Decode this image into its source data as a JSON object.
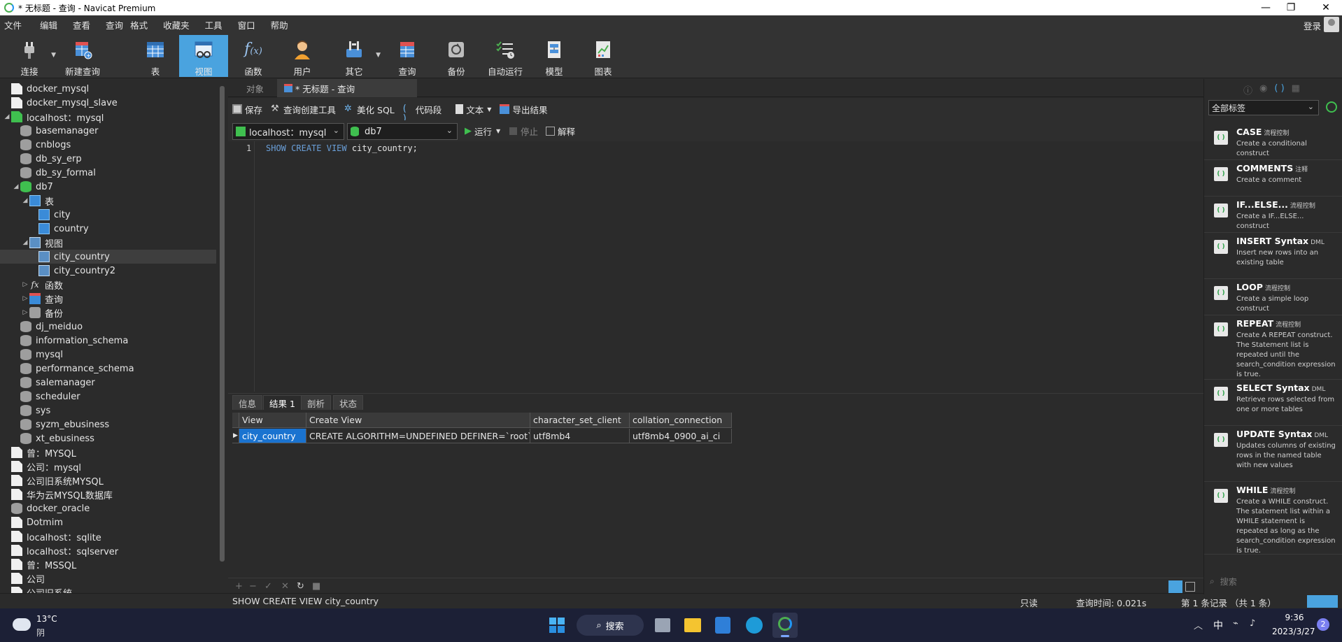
{
  "window": {
    "title": "* 无标题 - 查询 - Navicat Premium",
    "controls": [
      "—",
      "❐",
      "✕"
    ]
  },
  "menu": {
    "items": [
      "文件",
      "编辑",
      "查看",
      "查询",
      "格式",
      "收藏夹",
      "工具",
      "窗口",
      "帮助"
    ],
    "login_label": "登录"
  },
  "toolbar": {
    "items": [
      {
        "label": "连接",
        "icon": "plug-icon"
      },
      {
        "label": "新建查询",
        "icon": "new-query-icon"
      },
      {
        "label": "表",
        "icon": "table-icon"
      },
      {
        "label": "视图",
        "icon": "view-icon"
      },
      {
        "label": "函数",
        "icon": "function-icon"
      },
      {
        "label": "用户",
        "icon": "user-icon"
      },
      {
        "label": "其它",
        "icon": "tools-icon"
      },
      {
        "label": "查询",
        "icon": "query-icon"
      },
      {
        "label": "备份",
        "icon": "backup-icon"
      },
      {
        "label": "自动运行",
        "icon": "auto-run-icon"
      },
      {
        "label": "模型",
        "icon": "model-icon"
      },
      {
        "label": "图表",
        "icon": "chart-icon"
      }
    ],
    "active": "视图"
  },
  "tree": {
    "items": [
      {
        "label": "docker_mysql",
        "kind": "conn"
      },
      {
        "label": "docker_mysql_slave",
        "kind": "conn"
      },
      {
        "label": "localhost：mysql",
        "kind": "conn-open"
      },
      {
        "label": "basemanager",
        "kind": "db"
      },
      {
        "label": "cnblogs",
        "kind": "db"
      },
      {
        "label": "db_sy_erp",
        "kind": "db"
      },
      {
        "label": "db_sy_formal",
        "kind": "db"
      },
      {
        "label": "db7",
        "kind": "db-open"
      },
      {
        "label": "表",
        "kind": "tables"
      },
      {
        "label": "city",
        "kind": "table"
      },
      {
        "label": "country",
        "kind": "table"
      },
      {
        "label": "视图",
        "kind": "views"
      },
      {
        "label": "city_country",
        "kind": "view",
        "selected": true
      },
      {
        "label": "city_country2",
        "kind": "view"
      },
      {
        "label": "函数",
        "kind": "functions"
      },
      {
        "label": "查询",
        "kind": "queries"
      },
      {
        "label": "备份",
        "kind": "backups"
      },
      {
        "label": "dj_meiduo",
        "kind": "db"
      },
      {
        "label": "information_schema",
        "kind": "db"
      },
      {
        "label": "mysql",
        "kind": "db"
      },
      {
        "label": "performance_schema",
        "kind": "db"
      },
      {
        "label": "salemanager",
        "kind": "db"
      },
      {
        "label": "scheduler",
        "kind": "db"
      },
      {
        "label": "sys",
        "kind": "db"
      },
      {
        "label": "syzm_ebusiness",
        "kind": "db"
      },
      {
        "label": "xt_ebusiness",
        "kind": "db"
      },
      {
        "label": "曾：MYSQL",
        "kind": "conn"
      },
      {
        "label": "公司：mysql",
        "kind": "conn"
      },
      {
        "label": "公司旧系统MYSQL",
        "kind": "conn"
      },
      {
        "label": "华为云MYSQL数据库",
        "kind": "conn"
      },
      {
        "label": "docker_oracle",
        "kind": "conn-oracle"
      },
      {
        "label": "Dotmim",
        "kind": "conn-sqlite"
      },
      {
        "label": "localhost：sqlite",
        "kind": "conn-sqlite"
      },
      {
        "label": "localhost：sqlserver",
        "kind": "conn"
      },
      {
        "label": "曾：MSSQL",
        "kind": "conn"
      },
      {
        "label": "公司",
        "kind": "conn"
      },
      {
        "label": "公司旧系统",
        "kind": "conn"
      }
    ]
  },
  "tabs": {
    "objects": "对象",
    "query": "* 无标题 - 查询"
  },
  "query_toolbar": {
    "save": "保存",
    "builder": "查询创建工具",
    "beautify": "美化 SQL",
    "snippet": "代码段",
    "text": "文本",
    "export": "导出结果",
    "connection": "localhost：mysql",
    "database": "db7",
    "run": "运行",
    "stop": "停止",
    "explain": "解释"
  },
  "editor": {
    "line_number": "1",
    "kw1": "SHOW",
    "kw2": "CREATE",
    "kw3": "VIEW",
    "rest": "city_country;"
  },
  "result_tabs": [
    "信息",
    "结果 1",
    "剖析",
    "状态"
  ],
  "result_tabs_active": "结果 1",
  "result_grid": {
    "columns": [
      "View",
      "Create View",
      "character_set_client",
      "collation_connection"
    ],
    "rows": [
      [
        "city_country",
        "CREATE ALGORITHM=UNDEFINED DEFINER=`root`@`l",
        "utf8mb4",
        "utf8mb4_0900_ai_ci"
      ]
    ]
  },
  "status": {
    "sql": "SHOW CREATE VIEW city_country",
    "readonly": "只读",
    "query_time": "查询时间: 0.021s",
    "records": "第 1 条记录 （共 1 条）"
  },
  "right_panel": {
    "filter": "全部标签",
    "search_placeholder": "搜索",
    "snippets": [
      {
        "title": "CASE",
        "tag": "流程控制",
        "desc": "Create a conditional construct"
      },
      {
        "title": "COMMENTS",
        "tag": "注释",
        "desc": "Create a comment"
      },
      {
        "title": "IF...ELSE...",
        "tag": "流程控制",
        "desc": "Create a IF...ELSE... construct"
      },
      {
        "title": "INSERT Syntax",
        "tag": "DML",
        "desc": "Insert new rows into an existing table"
      },
      {
        "title": "LOOP",
        "tag": "流程控制",
        "desc": "Create a simple loop construct"
      },
      {
        "title": "REPEAT",
        "tag": "流程控制",
        "desc": "Create A REPEAT construct. The Statement list is repeated until the search_condition expression is true."
      },
      {
        "title": "SELECT Syntax",
        "tag": "DML",
        "desc": "Retrieve rows selected from one or more tables"
      },
      {
        "title": "UPDATE Syntax",
        "tag": "DML",
        "desc": "Updates columns of existing rows in the named table with new values"
      },
      {
        "title": "WHILE",
        "tag": "流程控制",
        "desc": "Create a WHILE construct. The statement list within a WHILE statement is repeated as long as the search_condition expression is true."
      }
    ]
  },
  "taskbar": {
    "temp": "13°C",
    "weather": "阴",
    "search": "搜索",
    "ime": "中",
    "time": "9:36",
    "date": "2023/3/27",
    "badge": "2"
  }
}
